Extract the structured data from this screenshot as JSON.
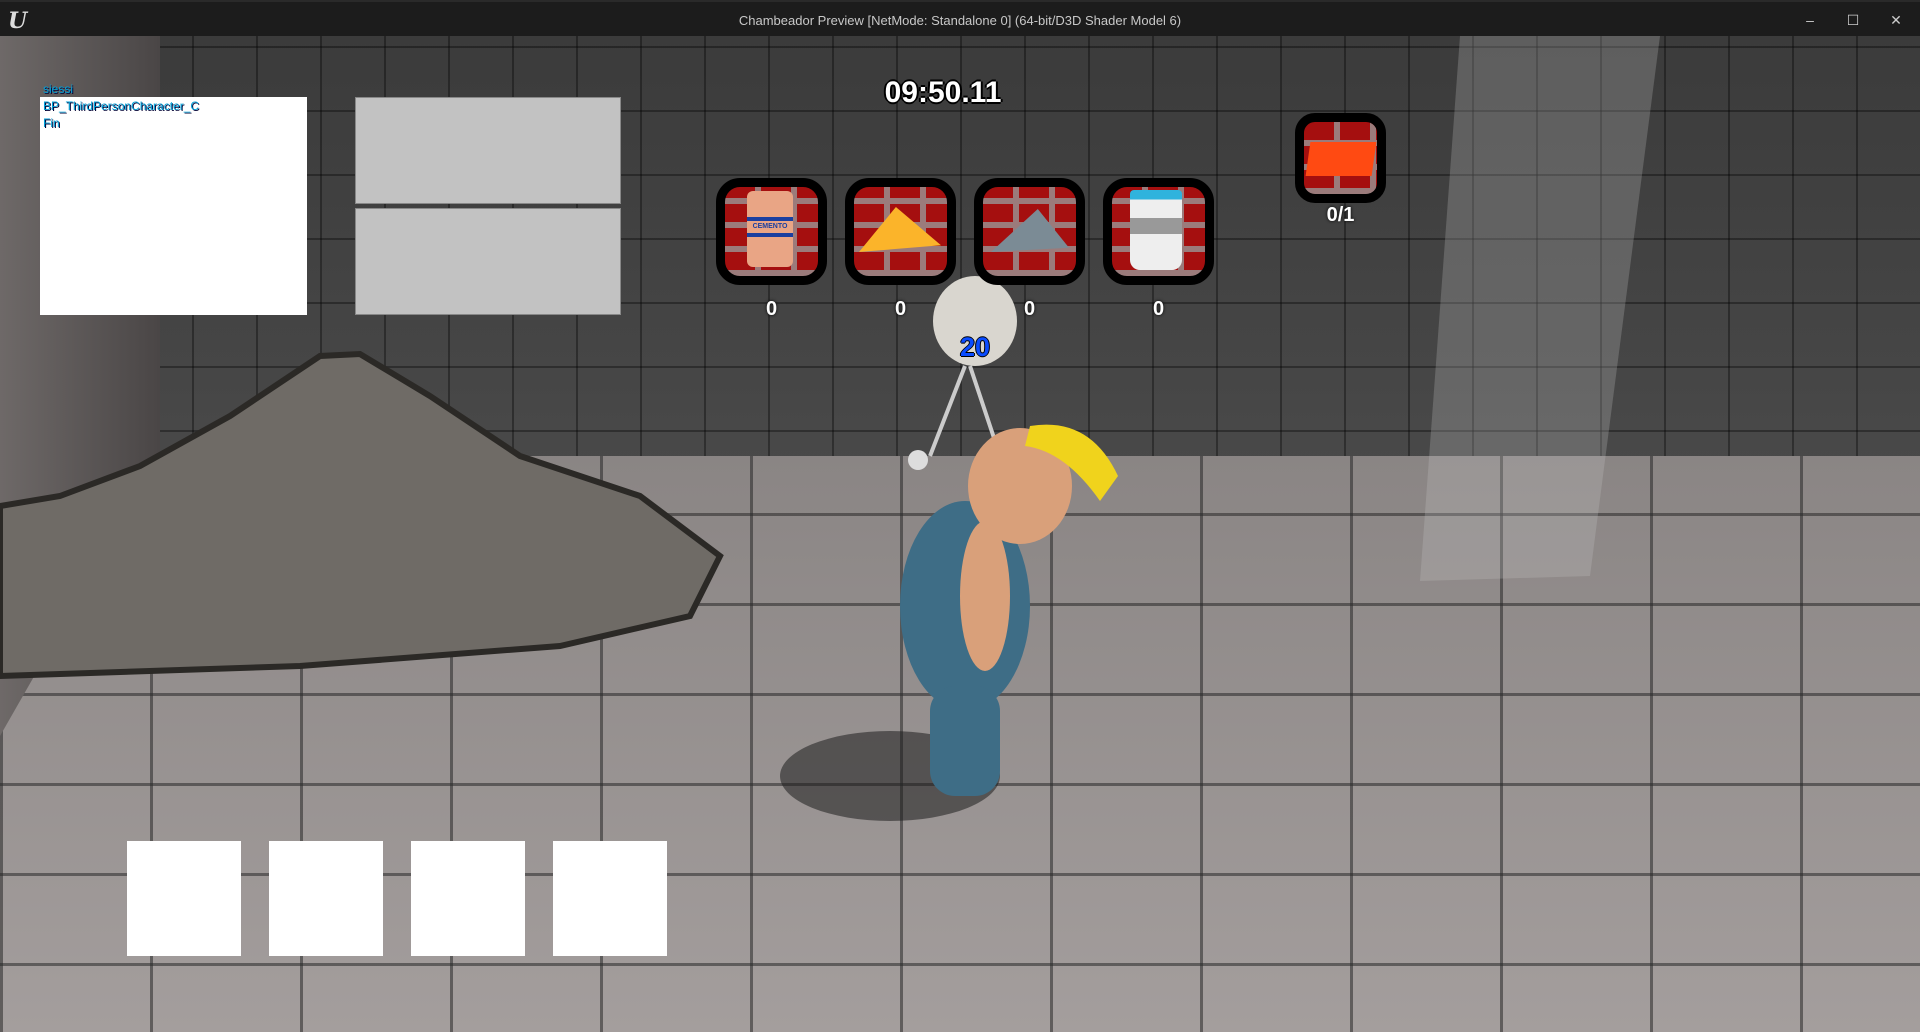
{
  "window": {
    "title": "Chambeador  Preview [NetMode: Standalone 0]  (64-bit/D3D Shader Model 6)",
    "logo": "U",
    "minimize": "–",
    "maximize": "☐",
    "close": "✕"
  },
  "debug": {
    "lines": [
      "siessi",
      "BP_ThirdPersonCharacter_C",
      "Fin"
    ]
  },
  "hud": {
    "timer": "09:50.11",
    "items": [
      {
        "icon": "cement-bag-icon",
        "label": "CEMENTO",
        "count": "0"
      },
      {
        "icon": "sand-pile-icon",
        "count": "0"
      },
      {
        "icon": "gravel-pile-icon",
        "count": "0"
      },
      {
        "icon": "water-bucket-icon",
        "count": "0"
      }
    ],
    "brick": {
      "icon": "brick-icon",
      "progress": "0/1"
    },
    "mixer_count": "20"
  },
  "colors": {
    "slot_bg": "#a50f0f",
    "debug_text": "#00a0d8",
    "mixer_count": "#0a4cff"
  }
}
